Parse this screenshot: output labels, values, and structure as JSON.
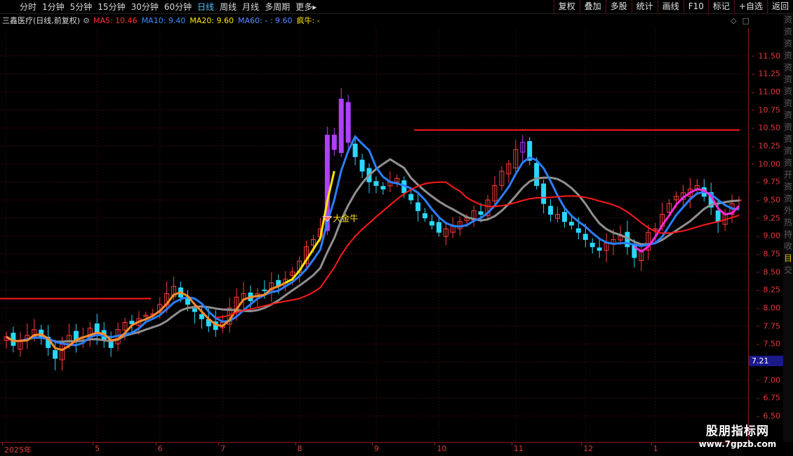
{
  "toolbar": {
    "periods": [
      "分时",
      "1分钟",
      "5分钟",
      "15分钟",
      "30分钟",
      "60分钟",
      "日线",
      "周线",
      "月线",
      "多周期",
      "更多"
    ],
    "active_period": "日线",
    "more_arrow": "▸",
    "right_buttons": [
      "复权",
      "叠加",
      "多股",
      "统计",
      "画线",
      "F10",
      "标记",
      "+自选",
      "返回"
    ]
  },
  "info_bar": {
    "stock": "三鑫医疗(日线,前复权)",
    "indicators": [
      {
        "label": "MA5: 10.46",
        "color": "#ff3030"
      },
      {
        "label": "MA10: 9.40",
        "color": "#3c8cff"
      },
      {
        "label": "MA20: 9.60",
        "color": "#ffe600"
      },
      {
        "label": "MA60: - : 9.60",
        "color": "#5a8cff"
      },
      {
        "label": "疯牛: -",
        "color": "#ffe600"
      }
    ]
  },
  "annotation": {
    "label": "大金牛"
  },
  "current_price": "7.21",
  "side_strip": [
    "资",
    "资",
    "资",
    "资",
    "资",
    "资",
    "资",
    "资",
    "资",
    "资",
    "资",
    "资",
    "资",
    "开",
    "资",
    "资",
    "外",
    "热",
    "持",
    "收",
    "目",
    "交"
  ],
  "watermark": {
    "title": "股朋指标网",
    "url": "www.7gpzb.com"
  },
  "colors": {
    "up": "#ff3c3c",
    "down": "#28d9ff",
    "ma_yellow": "#ffe600",
    "ma_red": "#ff1a1a",
    "ma_gray": "#909090",
    "ma_blue": "#2a7fff",
    "ma_orange": "#ff8c2a",
    "ma_magenta": "#ff2ad8"
  },
  "chart_data": {
    "type": "candlestick",
    "ylim": [
      6.5,
      11.75
    ],
    "y_ticks": [
      "6.50",
      "6.75",
      "7.00",
      "7.25",
      "7.50",
      "7.75",
      "8.00",
      "8.25",
      "8.50",
      "8.75",
      "9.00",
      "9.25",
      "9.50",
      "9.75",
      "10.00",
      "10.25",
      "10.50",
      "10.75",
      "11.00",
      "11.25",
      "11.50"
    ],
    "x_tick_labels": [
      "2025年",
      "5",
      "6",
      "7",
      "8",
      "9",
      "10",
      "11",
      "12",
      "1"
    ],
    "x_tick_index": [
      0,
      13,
      22,
      31,
      42,
      53,
      62,
      73,
      83,
      93
    ],
    "candles_count": 106,
    "closes": [
      7.6,
      7.48,
      7.55,
      7.62,
      7.7,
      7.58,
      7.45,
      7.3,
      7.5,
      7.62,
      7.55,
      7.6,
      7.72,
      7.65,
      7.55,
      7.45,
      7.7,
      7.8,
      7.78,
      7.85,
      7.9,
      7.92,
      8.05,
      8.2,
      8.3,
      8.15,
      8.05,
      7.95,
      7.85,
      7.75,
      7.7,
      7.8,
      8.0,
      8.15,
      8.2,
      8.1,
      8.2,
      8.25,
      8.35,
      8.3,
      8.4,
      8.5,
      8.65,
      8.85,
      8.95,
      9.1,
      10.4,
      10.2,
      10.9,
      10.3,
      10.1,
      9.9,
      9.75,
      9.7,
      9.65,
      9.75,
      9.8,
      9.6,
      9.5,
      9.35,
      9.25,
      9.15,
      9.05,
      9.1,
      9.15,
      9.2,
      9.25,
      9.35,
      9.3,
      9.5,
      9.7,
      9.9,
      10.0,
      10.2,
      10.3,
      10.05,
      9.7,
      9.45,
      9.3,
      9.3,
      9.2,
      9.15,
      9.05,
      8.95,
      8.85,
      8.8,
      8.9,
      8.95,
      9.0,
      8.85,
      8.7,
      8.8,
      9.05,
      9.1,
      9.3,
      9.45,
      9.55,
      9.6,
      9.65,
      9.7,
      9.55,
      9.4,
      9.2,
      9.3,
      9.45,
      9.5
    ],
    "resistance_levels": [
      8.13,
      10.47
    ],
    "lines": [
      {
        "name": "MA5",
        "value": 10.46
      },
      {
        "name": "MA10",
        "value": 9.4
      },
      {
        "name": "MA20",
        "value": 9.6
      }
    ]
  }
}
